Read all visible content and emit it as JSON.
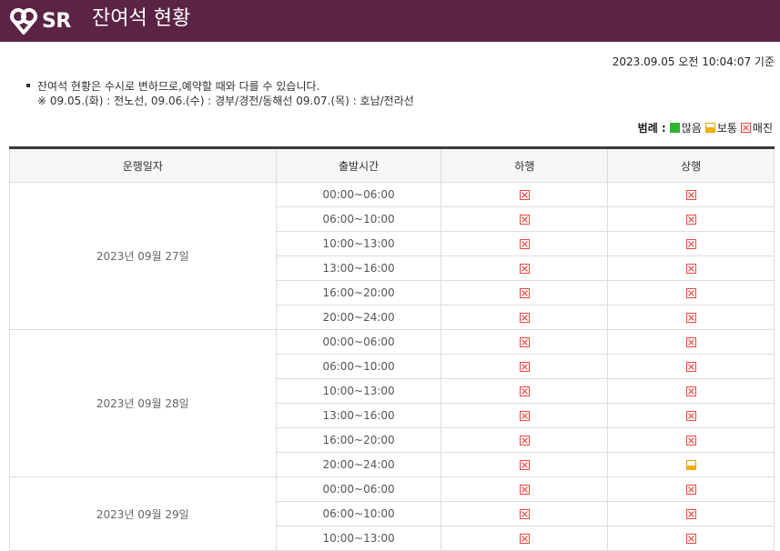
{
  "header": {
    "logo_text": "SR",
    "title": "잔여석 현황"
  },
  "timestamp": "2023.09.05 오전 10:04:07 기준",
  "notice": {
    "line1": "잔여석 현황은 수시로 변하므로,예약할 때와 다를 수 있습니다.",
    "line2": "※ 09.05.(화) : 전노선, 09.06.(수) : 경부/경전/동해선 09.07.(목) : 호남/전라선"
  },
  "legend": {
    "label": "범례 :",
    "many": "많음",
    "normal": "보통",
    "full": "매진"
  },
  "table": {
    "headers": [
      "운행일자",
      "출발시간",
      "하행",
      "상행"
    ],
    "groups": [
      {
        "date": "2023년 09월 27일",
        "rows": [
          {
            "time": "00:00~06:00",
            "down": "full",
            "up": "full"
          },
          {
            "time": "06:00~10:00",
            "down": "full",
            "up": "full"
          },
          {
            "time": "10:00~13:00",
            "down": "full",
            "up": "full"
          },
          {
            "time": "13:00~16:00",
            "down": "full",
            "up": "full"
          },
          {
            "time": "16:00~20:00",
            "down": "full",
            "up": "full"
          },
          {
            "time": "20:00~24:00",
            "down": "full",
            "up": "full"
          }
        ]
      },
      {
        "date": "2023년 09월 28일",
        "rows": [
          {
            "time": "00:00~06:00",
            "down": "full",
            "up": "full"
          },
          {
            "time": "06:00~10:00",
            "down": "full",
            "up": "full"
          },
          {
            "time": "10:00~13:00",
            "down": "full",
            "up": "full"
          },
          {
            "time": "13:00~16:00",
            "down": "full",
            "up": "full"
          },
          {
            "time": "16:00~20:00",
            "down": "full",
            "up": "full"
          },
          {
            "time": "20:00~24:00",
            "down": "full",
            "up": "normal"
          }
        ]
      },
      {
        "date": "2023년 09월 29일",
        "rows": [
          {
            "time": "00:00~06:00",
            "down": "full",
            "up": "full"
          },
          {
            "time": "06:00~10:00",
            "down": "full",
            "up": "full"
          },
          {
            "time": "10:00~13:00",
            "down": "full",
            "up": "full"
          }
        ]
      }
    ]
  },
  "colors": {
    "header_bg": "#5b2445",
    "many": "#2db52d",
    "normal": "#f2b400",
    "full": "#e8473f"
  }
}
